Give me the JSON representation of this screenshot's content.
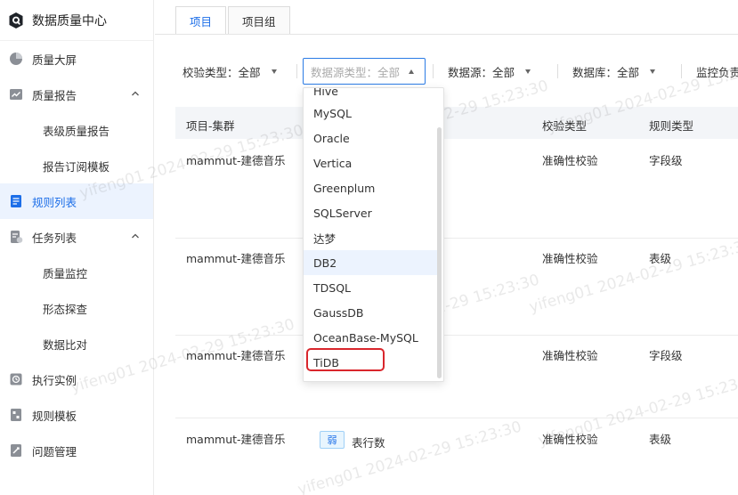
{
  "app": {
    "title": "数据质量中心"
  },
  "sidebar": {
    "items": [
      {
        "label": "质量大屏",
        "icon": "pie-chart-icon"
      },
      {
        "label": "质量报告",
        "icon": "line-chart-icon",
        "expanded": true
      },
      {
        "label": "表级质量报告",
        "sub": true
      },
      {
        "label": "报告订阅模板",
        "sub": true
      },
      {
        "label": "规则列表",
        "icon": "list-doc-icon",
        "active": true
      },
      {
        "label": "任务列表",
        "icon": "task-doc-icon",
        "expanded": true
      },
      {
        "label": "质量监控",
        "sub": true
      },
      {
        "label": "形态探查",
        "sub": true
      },
      {
        "label": "数据比对",
        "sub": true
      },
      {
        "label": "执行实例",
        "icon": "instance-icon"
      },
      {
        "label": "规则模板",
        "icon": "template-icon"
      },
      {
        "label": "问题管理",
        "icon": "issue-icon"
      }
    ]
  },
  "tabs": [
    {
      "label": "项目",
      "active": true
    },
    {
      "label": "项目组"
    }
  ],
  "filters": {
    "check_type": "校验类型：全部",
    "datasource_type_placeholder": "数据源类型：全部",
    "datasource": "数据源：全部",
    "database": "数据库：全部",
    "monitor_owner": "监控负责"
  },
  "table": {
    "headers": {
      "project_cluster": "项目-集群",
      "check_type": "校验类型",
      "rule_type": "规则类型"
    },
    "rows": [
      {
        "project": "mammut-建德音乐",
        "check_type": "准确性校验",
        "rule_type": "字段级"
      },
      {
        "project": "mammut-建德音乐",
        "check_type": "准确性校验",
        "rule_type": "表级"
      },
      {
        "project": "mammut-建德音乐",
        "check_type": "准确性校验",
        "rule_type": "字段级"
      },
      {
        "project": "mammut-建德音乐",
        "tag": "弱",
        "rule_name": "表行数",
        "check_type": "准确性校验",
        "rule_type": "表级"
      }
    ]
  },
  "dropdown": {
    "options": [
      "Hive",
      "MySQL",
      "Oracle",
      "Vertica",
      "Greenplum",
      "SQLServer",
      "达梦",
      "DB2",
      "TDSQL",
      "GaussDB",
      "OceanBase-MySQL",
      "TiDB"
    ],
    "highlighted": "DB2",
    "marked": "TiDB"
  },
  "watermark": "yifeng01 2024-02-29 15:23:30",
  "colors": {
    "accent": "#1c6ee8",
    "highlight_bg": "#ecf3fe",
    "marker_red": "#d9262c"
  }
}
